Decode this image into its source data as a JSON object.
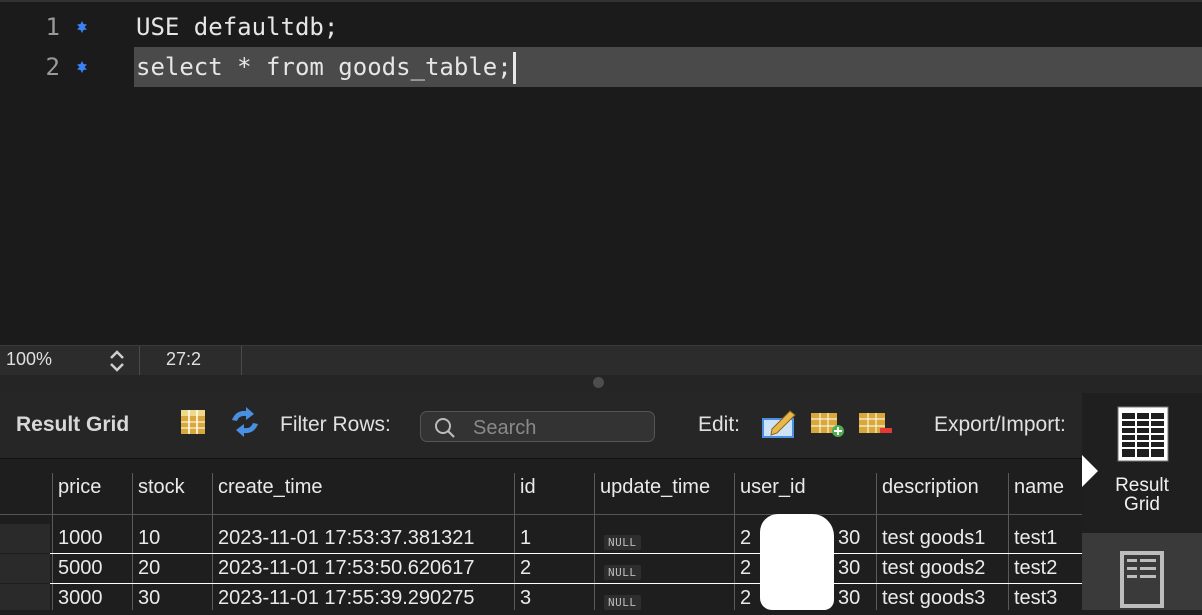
{
  "editor": {
    "lines": [
      {
        "number": "1",
        "code": "USE defaultdb;"
      },
      {
        "number": "2",
        "code": "select * from goods_table;"
      }
    ]
  },
  "status": {
    "zoom": "100%",
    "cursor": "27:2"
  },
  "toolbar": {
    "title": "Result Grid",
    "filter_label": "Filter Rows:",
    "search_placeholder": "Search",
    "edit_label": "Edit:",
    "export_label": "Export/Import:"
  },
  "grid": {
    "columns": [
      "price",
      "stock",
      "create_time",
      "id",
      "update_time",
      "user_id",
      "description",
      "name"
    ],
    "rows": [
      [
        "1000",
        "10",
        "2023-11-01 17:53:37.381321",
        "1",
        "NULL",
        "2",
        "30",
        "test goods1",
        "test1"
      ],
      [
        "5000",
        "20",
        "2023-11-01 17:53:50.620617",
        "2",
        "NULL",
        "2",
        "30",
        "test goods2",
        "test2"
      ],
      [
        "3000",
        "30",
        "2023-11-01 17:55:39.290275",
        "3",
        "NULL",
        "2",
        "30",
        "test goods3",
        "test3"
      ]
    ]
  },
  "side_panel": {
    "result_grid_label_1": "Result",
    "result_grid_label_2": "Grid"
  },
  "colors": {
    "marker": "#3b82f6",
    "highlight": "#4a4a4a",
    "background": "#1b1b1b"
  }
}
